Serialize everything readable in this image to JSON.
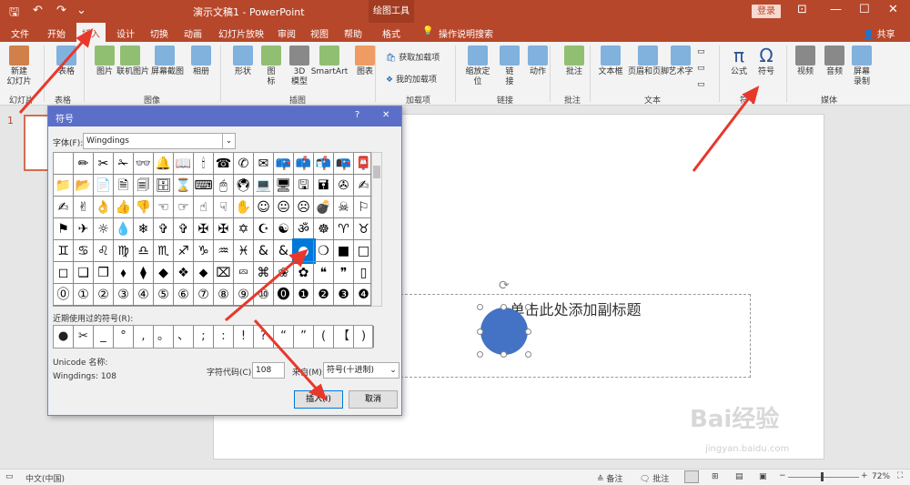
{
  "titlebar": {
    "doc_title": "演示文稿1 - PowerPoint",
    "context_title": "绘图工具",
    "login": "登录",
    "qa_icons": [
      "save-icon",
      "undo-icon",
      "redo-icon",
      "customize-icon"
    ],
    "qa_glyphs": [
      "🖫",
      "↶",
      "↷",
      "⌄"
    ],
    "window_controls": [
      "restore-ribbon-icon",
      "minimize-icon",
      "maximize-icon",
      "close-icon"
    ],
    "window_glyphs": [
      "⊡",
      "—",
      "☐",
      "✕"
    ]
  },
  "tabs": [
    "文件",
    "开始",
    "插入",
    "设计",
    "切换",
    "动画",
    "幻灯片放映",
    "审阅",
    "视图",
    "帮助",
    "格式"
  ],
  "active_tab": "插入",
  "tell_me": "操作说明搜索",
  "share": "共享",
  "ribbon": {
    "buttons": [
      {
        "id": "new-slide",
        "label": "新建\n幻灯片",
        "color": "#c55a11"
      },
      {
        "id": "table",
        "label": "表格",
        "color": "#5b9bd5"
      },
      {
        "id": "picture",
        "label": "图片",
        "color": "#70ad47"
      },
      {
        "id": "online-picture",
        "label": "联机图片",
        "color": "#70ad47"
      },
      {
        "id": "screenshot",
        "label": "屏幕截图",
        "color": "#5b9bd5"
      },
      {
        "id": "album",
        "label": "相册",
        "color": "#5b9bd5"
      },
      {
        "id": "shapes",
        "label": "形状",
        "color": "#5b9bd5"
      },
      {
        "id": "icons",
        "label": "图\n标",
        "color": "#70ad47"
      },
      {
        "id": "3d-models",
        "label": "3D\n模型",
        "color": "#666666"
      },
      {
        "id": "smartart",
        "label": "SmartArt",
        "color": "#70ad47"
      },
      {
        "id": "chart",
        "label": "图表",
        "color": "#ed7d31"
      },
      {
        "id": "zoom",
        "label": "缩放定\n位",
        "color": "#5b9bd5"
      },
      {
        "id": "link",
        "label": "链\n接",
        "color": "#5b9bd5"
      },
      {
        "id": "action",
        "label": "动作",
        "color": "#5b9bd5"
      },
      {
        "id": "comment",
        "label": "批注",
        "color": "#70ad47"
      },
      {
        "id": "textbox",
        "label": "文本框",
        "color": "#5b9bd5"
      },
      {
        "id": "header-footer",
        "label": "页眉和页脚",
        "color": "#5b9bd5"
      },
      {
        "id": "wordart",
        "label": "艺术字",
        "color": "#5b9bd5"
      },
      {
        "id": "equation",
        "label": "公式",
        "color": "#2e5597"
      },
      {
        "id": "symbol",
        "label": "符号",
        "color": "#2e5597"
      },
      {
        "id": "video",
        "label": "视频",
        "color": "#666666"
      },
      {
        "id": "audio",
        "label": "音频",
        "color": "#666666"
      },
      {
        "id": "screen-recording",
        "label": "屏幕\n录制",
        "color": "#5b9bd5"
      }
    ],
    "addins": [
      "获取加载项",
      "我的加载项"
    ],
    "groups": [
      "幻灯片",
      "表格",
      "图像",
      "插图",
      "加载项",
      "链接",
      "批注",
      "文本",
      "符号",
      "媒体"
    ]
  },
  "thumbnail_number": "1",
  "slide": {
    "subtitle_placeholder": "单击此处添加副标题"
  },
  "dialog": {
    "title": "符号",
    "help": "?",
    "close": "✕",
    "font_label": "字体(F):",
    "font_value": "Wingdings",
    "recent_label": "近期使用过的符号(R):",
    "unicode_label": "Unicode 名称:",
    "unicode_value": "Wingdings: 108",
    "charcode_label": "字符代码(C):",
    "charcode_value": "108",
    "from_label": "来自(M):",
    "from_value": "符号(十进制)",
    "insert_button": "插入(I)",
    "cancel_button": "取消",
    "symbols": [
      [
        "",
        "✏",
        "✂",
        "✁",
        "👓",
        "🔔",
        "📖",
        "🕯",
        "☎",
        "✆",
        "✉",
        "📪",
        "📫",
        "📬",
        "📭",
        "📮"
      ],
      [
        "📁",
        "📂",
        "📄",
        "🗎",
        "🗐",
        "🗄",
        "⌛",
        "⌨",
        "🖱",
        "🖲",
        "💻",
        "🖥",
        "🖫",
        "🖬",
        "✇",
        "✍"
      ],
      [
        "✍",
        "✌",
        "👌",
        "👍",
        "👎",
        "☜",
        "☞",
        "☝",
        "☟",
        "✋",
        "☺",
        "😐",
        "☹",
        "💣",
        "☠",
        "⚐"
      ],
      [
        "⚑",
        "✈",
        "☼",
        "💧",
        "❄",
        "✞",
        "✞",
        "✠",
        "✠",
        "✡",
        "☪",
        "☯",
        "ॐ",
        "☸",
        "♈",
        "♉"
      ],
      [
        "♊",
        "♋",
        "♌",
        "♍",
        "♎",
        "♏",
        "♐",
        "♑",
        "♒",
        "♓",
        "&",
        "&",
        "●",
        "❍",
        "■",
        "□"
      ],
      [
        "◻",
        "❑",
        "❒",
        "⬧",
        "⧫",
        "◆",
        "❖",
        "⬥",
        "⌧",
        "⮹",
        "⌘",
        "❀",
        "✿",
        "❝",
        "❞",
        "▯"
      ],
      [
        "⓪",
        "①",
        "②",
        "③",
        "④",
        "⑤",
        "⑥",
        "⑦",
        "⑧",
        "⑨",
        "⑩",
        "⓿",
        "❶",
        "❷",
        "❸",
        "❹"
      ]
    ],
    "selected_row": 4,
    "selected_col": 12,
    "recent_symbols": [
      "●",
      "✂",
      "_",
      "°",
      ",",
      "。",
      "、",
      ";",
      ":",
      "!",
      "?",
      "“",
      "”",
      "(",
      "【",
      ")"
    ]
  },
  "status": {
    "slide_info": "中文(中国)",
    "notes": "备注",
    "comments": "批注",
    "zoom": "72%"
  },
  "watermark": {
    "brand": "Bai经验",
    "url": "jingyan.baidu.com"
  }
}
